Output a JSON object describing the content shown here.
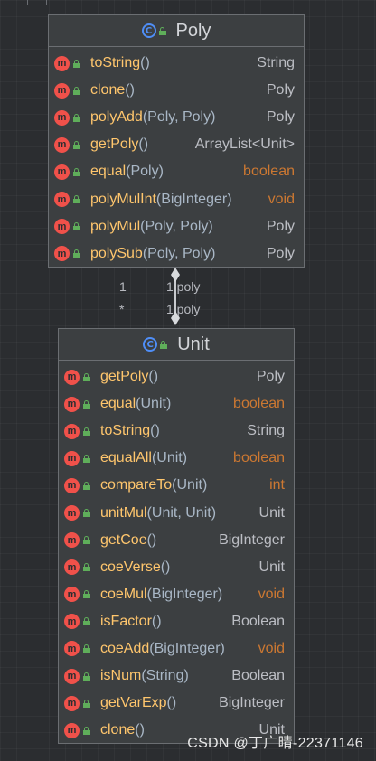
{
  "diagram": {
    "classes": [
      {
        "name": "Poly",
        "members": [
          {
            "name": "toString",
            "params": "()",
            "ret": "String",
            "ret_kw": false
          },
          {
            "name": "clone",
            "params": "()",
            "ret": "Poly",
            "ret_kw": false
          },
          {
            "name": "polyAdd",
            "params": "(Poly, Poly)",
            "ret": "Poly",
            "ret_kw": false
          },
          {
            "name": "getPoly",
            "params": "()",
            "ret": "ArrayList<Unit>",
            "ret_kw": false
          },
          {
            "name": "equal",
            "params": "(Poly)",
            "ret": "boolean",
            "ret_kw": true
          },
          {
            "name": "polyMulInt",
            "params": "(BigInteger)",
            "ret": "void",
            "ret_kw": true
          },
          {
            "name": "polyMul",
            "params": "(Poly, Poly)",
            "ret": "Poly",
            "ret_kw": false
          },
          {
            "name": "polySub",
            "params": "(Poly, Poly)",
            "ret": "Poly",
            "ret_kw": false
          }
        ]
      },
      {
        "name": "Unit",
        "members": [
          {
            "name": "getPoly",
            "params": "()",
            "ret": "Poly",
            "ret_kw": false
          },
          {
            "name": "equal",
            "params": "(Unit)",
            "ret": "boolean",
            "ret_kw": true
          },
          {
            "name": "toString",
            "params": "()",
            "ret": "String",
            "ret_kw": false
          },
          {
            "name": "equalAll",
            "params": "(Unit)",
            "ret": "boolean",
            "ret_kw": true
          },
          {
            "name": "compareTo",
            "params": "(Unit)",
            "ret": "int",
            "ret_kw": true
          },
          {
            "name": "unitMul",
            "params": "(Unit, Unit)",
            "ret": "Unit",
            "ret_kw": false
          },
          {
            "name": "getCoe",
            "params": "()",
            "ret": "BigInteger",
            "ret_kw": false
          },
          {
            "name": "coeVerse",
            "params": "()",
            "ret": "Unit",
            "ret_kw": false
          },
          {
            "name": "coeMul",
            "params": "(BigInteger)",
            "ret": "void",
            "ret_kw": true
          },
          {
            "name": "isFactor",
            "params": "()",
            "ret": "Boolean",
            "ret_kw": false
          },
          {
            "name": "coeAdd",
            "params": "(BigInteger)",
            "ret": "void",
            "ret_kw": true
          },
          {
            "name": "isNum",
            "params": "(String)",
            "ret": "Boolean",
            "ret_kw": false
          },
          {
            "name": "getVarExp",
            "params": "()",
            "ret": "BigInteger",
            "ret_kw": false
          },
          {
            "name": "clone",
            "params": "()",
            "ret": "Unit",
            "ret_kw": false
          }
        ]
      }
    ],
    "association": {
      "left_top": "1",
      "left_bottom": "*",
      "right_top": "1 poly",
      "right_bottom": "1 poly"
    },
    "icons": {
      "class": "class-icon",
      "visibility": "lock-icon",
      "method": "method-icon"
    },
    "colors": {
      "background": "#2b2d30",
      "method_name": "#ffc66d",
      "keyword": "#cc7832",
      "method_icon": "#f0514a",
      "class_icon": "#4f8ef7",
      "lock": "#5fae5a"
    }
  },
  "watermark": "CSDN @丁广晴-22371146"
}
